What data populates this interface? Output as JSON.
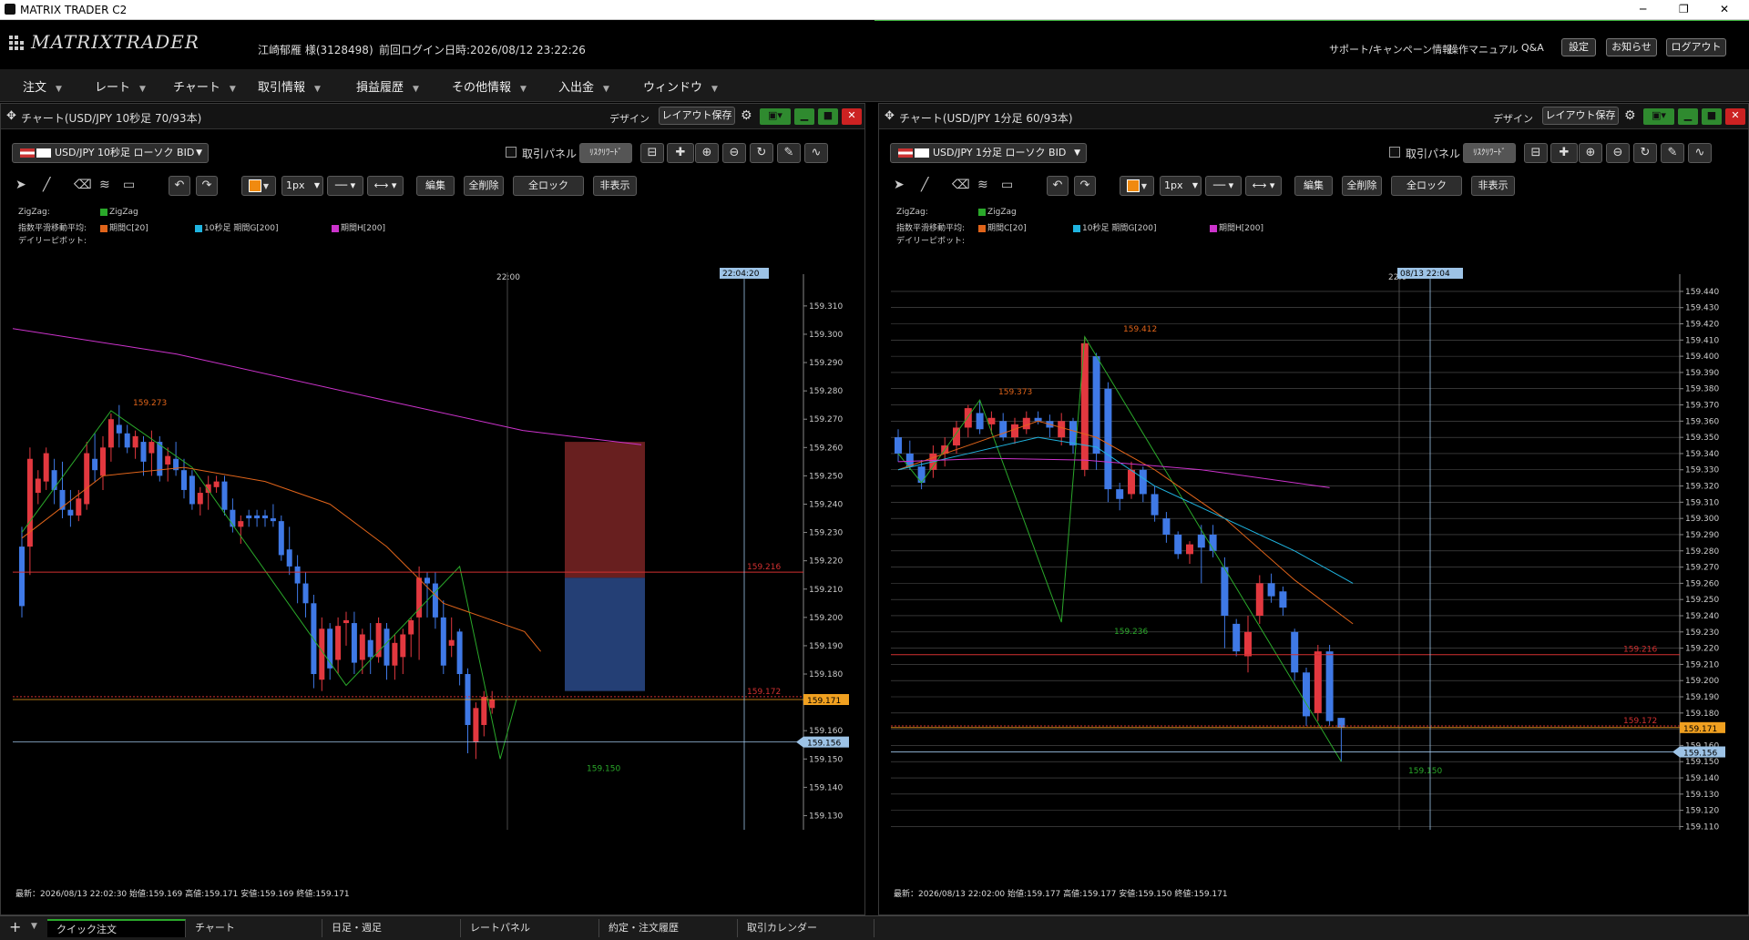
{
  "window": {
    "title": "MATRIX TRADER C2",
    "minimize": "─",
    "maximize": "❐",
    "close": "✕"
  },
  "header": {
    "logo": "MATRIXTRADER",
    "user": "江崎郁雁 様(3128498)",
    "last_login": "前回ログイン日時:2026/08/12 23:22:26",
    "links": [
      "サポート/キャンペーン情報",
      "操作マニュアル",
      "Q&A"
    ],
    "buttons": [
      "設定",
      "お知らせ",
      "ログアウト"
    ]
  },
  "menu": [
    "注文",
    "レート",
    "チャート",
    "取引情報",
    "損益履歴",
    "その他情報",
    "入出金",
    "ウィンドウ"
  ],
  "colors": {
    "up": "#e2383f",
    "down": "#3f79e6",
    "zigzag": "#2aa82a",
    "ma_c": "#e0641a",
    "ma_g": "#1fb4e0",
    "ma_h": "#cc33cc",
    "bid_tag": "#f0a020",
    "mouse_tag": "#9dc3e6"
  },
  "panels": [
    {
      "title": "チャート(USD/JPY 10秒足 70/93本)",
      "design_label": "デザイン",
      "save_label": "レイアウト保存",
      "symbol_select": "USD/JPY 10秒足 ローソク BID",
      "trade_panel_label": "取引パネル",
      "risk_reward_label": "ﾘｽｸﾘﾜｰﾄﾞ",
      "tools": {
        "linewidth": "1px",
        "edit": "編集",
        "delete_all": "全削除",
        "lock_all": "全ロック",
        "hide": "非表示"
      },
      "legend": {
        "row1_label": "ZigZag:",
        "zigzag_name": "ZigZag",
        "row2_label": "指数平滑移動平均:",
        "ma_c": "期間C[20]",
        "ma_g": "10秒足 期間G[200]",
        "ma_h": "期間H[200]",
        "row3_label": "デイリーピボット:"
      },
      "time_label": "22:00",
      "cursor_time": "22:04:20",
      "status": "最新：2026/08/13 22:02:30 始値:159.169 高値:159.171 安値:159.169 終値:159.171",
      "y_ticks": [
        "159.310",
        "159.300",
        "159.290",
        "159.280",
        "159.270",
        "159.260",
        "159.250",
        "159.240",
        "159.230",
        "159.220",
        "159.210",
        "159.200",
        "159.190",
        "159.180",
        "159.170",
        "159.160",
        "159.150",
        "159.140",
        "159.130"
      ],
      "labels": {
        "high": "159.273",
        "low": "159.150",
        "red_line": "159.216",
        "red_dotted": "159.172",
        "bid": "159.171",
        "mouse": "159.156"
      }
    },
    {
      "title": "チャート(USD/JPY 1分足 60/93本)",
      "design_label": "デザイン",
      "save_label": "レイアウト保存",
      "symbol_select": "USD/JPY 1分足 ローソク BID",
      "trade_panel_label": "取引パネル",
      "risk_reward_label": "ﾘｽｸﾘﾜｰﾄﾞ",
      "tools": {
        "linewidth": "1px",
        "edit": "編集",
        "delete_all": "全削除",
        "lock_all": "全ロック",
        "hide": "非表示"
      },
      "legend": {
        "row1_label": "ZigZag:",
        "zigzag_name": "ZigZag",
        "row2_label": "指数平滑移動平均:",
        "ma_c": "期間C[20]",
        "ma_g": "10秒足 期間G[200]",
        "ma_h": "期間H[200]",
        "row3_label": "デイリーピボット:"
      },
      "time_label": "22:0",
      "cursor_time": "08/13 22:04",
      "status": "最新：2026/08/13 22:02:00 始値:159.177 高値:159.177 安値:159.150 終値:159.171",
      "y_ticks": [
        "159.440",
        "159.430",
        "159.420",
        "159.410",
        "159.400",
        "159.390",
        "159.380",
        "159.370",
        "159.360",
        "159.350",
        "159.340",
        "159.330",
        "159.320",
        "159.310",
        "159.300",
        "159.290",
        "159.280",
        "159.270",
        "159.260",
        "159.250",
        "159.240",
        "159.230",
        "159.220",
        "159.210",
        "159.200",
        "159.190",
        "159.180",
        "159.170",
        "159.160",
        "159.150",
        "159.140",
        "159.130",
        "159.120",
        "159.110"
      ],
      "labels": {
        "high": "159.412",
        "high2": "159.373",
        "low": "159.236",
        "low2": "159.150",
        "red_line": "159.216",
        "red_dotted": "159.172",
        "bid": "159.171",
        "mouse": "159.156"
      }
    }
  ],
  "chart_data": [
    {
      "type": "candlestick",
      "title": "チャート(USD/JPY 10秒足 70/93本)",
      "ylim": [
        159.125,
        159.318
      ],
      "x": [
        "",
        "22:00",
        ""
      ],
      "ohlc": [
        [
          159.225,
          159.232,
          159.2,
          159.204
        ],
        [
          159.225,
          159.26,
          159.215,
          159.256
        ],
        [
          159.244,
          159.252,
          159.24,
          159.249
        ],
        [
          159.248,
          159.26,
          159.245,
          159.258
        ],
        [
          159.252,
          159.256,
          159.24,
          159.245
        ],
        [
          159.245,
          159.255,
          159.235,
          159.238
        ],
        [
          159.238,
          159.245,
          159.232,
          159.236
        ],
        [
          159.236,
          159.245,
          159.234,
          159.242
        ],
        [
          159.24,
          159.262,
          159.238,
          159.258
        ],
        [
          159.256,
          159.265,
          159.248,
          159.252
        ],
        [
          159.25,
          159.264,
          159.245,
          159.26
        ],
        [
          159.26,
          159.272,
          159.255,
          159.27
        ],
        [
          159.268,
          159.275,
          159.26,
          159.265
        ],
        [
          159.265,
          159.268,
          159.258,
          159.26
        ],
        [
          159.26,
          159.266,
          159.256,
          159.264
        ],
        [
          159.262,
          159.264,
          159.25,
          159.255
        ],
        [
          159.258,
          159.266,
          159.25,
          159.262
        ],
        [
          159.262,
          159.264,
          159.248,
          159.25
        ],
        [
          159.254,
          159.26,
          159.248,
          159.257
        ],
        [
          159.256,
          159.262,
          159.25,
          159.252
        ],
        [
          159.252,
          159.256,
          159.242,
          159.245
        ],
        [
          159.25,
          159.252,
          159.238,
          159.24
        ],
        [
          159.24,
          159.246,
          159.236,
          159.244
        ],
        [
          159.244,
          159.25,
          159.238,
          159.247
        ],
        [
          159.246,
          159.25,
          159.244,
          159.248
        ],
        [
          159.248,
          159.25,
          159.236,
          159.238
        ],
        [
          159.238,
          159.242,
          159.23,
          159.232
        ],
        [
          159.232,
          159.236,
          159.226,
          159.234
        ],
        [
          159.236,
          159.238,
          159.232,
          159.235
        ],
        [
          159.236,
          159.238,
          159.232,
          159.235
        ],
        [
          159.236,
          159.238,
          159.232,
          159.235
        ],
        [
          159.235,
          159.24,
          159.232,
          159.234
        ],
        [
          159.234,
          159.236,
          159.22,
          159.222
        ],
        [
          159.224,
          159.232,
          159.215,
          159.218
        ],
        [
          159.218,
          159.222,
          159.205,
          159.212
        ],
        [
          159.212,
          159.216,
          159.2,
          159.205
        ],
        [
          159.205,
          159.208,
          159.175,
          159.18
        ],
        [
          159.178,
          159.2,
          159.174,
          159.196
        ],
        [
          159.196,
          159.198,
          159.178,
          159.182
        ],
        [
          159.185,
          159.2,
          159.18,
          159.197
        ],
        [
          159.198,
          159.202,
          159.19,
          159.199
        ],
        [
          159.198,
          159.202,
          159.18,
          159.184
        ],
        [
          159.185,
          159.196,
          159.18,
          159.194
        ],
        [
          159.192,
          159.198,
          159.18,
          159.186
        ],
        [
          159.186,
          159.2,
          159.184,
          159.198
        ],
        [
          159.196,
          159.198,
          159.178,
          159.183
        ],
        [
          159.183,
          159.194,
          159.178,
          159.191
        ],
        [
          159.186,
          159.196,
          159.18,
          159.194
        ],
        [
          159.194,
          159.2,
          159.186,
          159.199
        ],
        [
          159.2,
          159.218,
          159.185,
          159.214
        ],
        [
          159.214,
          159.216,
          159.2,
          159.212
        ],
        [
          159.212,
          159.216,
          159.196,
          159.2
        ],
        [
          159.2,
          159.206,
          159.18,
          159.183
        ],
        [
          159.19,
          159.2,
          159.186,
          159.192
        ],
        [
          159.195,
          159.196,
          159.176,
          159.18
        ],
        [
          159.18,
          159.182,
          159.152,
          159.162
        ],
        [
          159.156,
          159.17,
          159.15,
          159.168
        ],
        [
          159.162,
          159.174,
          159.158,
          159.172
        ],
        [
          159.168,
          159.174,
          159.166,
          159.171
        ]
      ],
      "series": [
        {
          "name": "ZigZag",
          "values": [
            159.23,
            159.273,
            159.253,
            159.176,
            159.218,
            159.15,
            159.171
          ]
        },
        {
          "name": "期間C[20]",
          "values": [
            159.228,
            159.25,
            159.253,
            159.248,
            159.24,
            159.225,
            159.205,
            159.2,
            159.195,
            159.188
          ]
        },
        {
          "name": "期間H[200]",
          "values": [
            159.302,
            159.293,
            159.278,
            159.266,
            159.261
          ]
        }
      ],
      "annotations": [
        "159.273",
        "159.150",
        "159.216",
        "159.172",
        "159.171",
        "159.156",
        "22:04:20"
      ]
    },
    {
      "type": "candlestick",
      "title": "チャート(USD/JPY 1分足 60/93本)",
      "ylim": [
        159.108,
        159.445
      ],
      "x": [
        "22:0",
        "08/13 22:04"
      ],
      "ohlc": [
        [
          159.35,
          159.355,
          159.335,
          159.34
        ],
        [
          159.34,
          159.348,
          159.33,
          159.332
        ],
        [
          159.332,
          159.336,
          159.318,
          159.322
        ],
        [
          159.33,
          159.345,
          159.325,
          159.34
        ],
        [
          159.34,
          159.35,
          159.332,
          159.345
        ],
        [
          159.345,
          159.36,
          159.34,
          159.356
        ],
        [
          159.356,
          159.37,
          159.35,
          159.368
        ],
        [
          159.365,
          159.373,
          159.352,
          159.355
        ],
        [
          159.358,
          159.366,
          159.352,
          159.362
        ],
        [
          159.36,
          159.365,
          159.348,
          159.35
        ],
        [
          159.35,
          159.362,
          159.346,
          159.358
        ],
        [
          159.355,
          159.366,
          159.352,
          159.362
        ],
        [
          159.362,
          159.366,
          159.358,
          159.36
        ],
        [
          159.36,
          159.364,
          159.35,
          159.356
        ],
        [
          159.35,
          159.365,
          159.345,
          159.36
        ],
        [
          159.36,
          159.362,
          159.34,
          159.345
        ],
        [
          159.33,
          159.412,
          159.326,
          159.408
        ],
        [
          159.4,
          159.402,
          159.33,
          159.34
        ],
        [
          159.38,
          159.384,
          159.31,
          159.318
        ],
        [
          159.318,
          159.322,
          159.305,
          159.312
        ],
        [
          159.315,
          159.335,
          159.312,
          159.33
        ],
        [
          159.33,
          159.332,
          159.31,
          159.315
        ],
        [
          159.315,
          159.32,
          159.298,
          159.302
        ],
        [
          159.3,
          159.304,
          159.285,
          159.29
        ],
        [
          159.29,
          159.292,
          159.275,
          159.278
        ],
        [
          159.278,
          159.286,
          159.272,
          159.284
        ],
        [
          159.29,
          159.296,
          159.26,
          159.282
        ],
        [
          159.29,
          159.296,
          159.276,
          159.28
        ],
        [
          159.27,
          159.276,
          159.22,
          159.24
        ],
        [
          159.235,
          159.238,
          159.215,
          159.218
        ],
        [
          159.215,
          159.24,
          159.205,
          159.23
        ],
        [
          159.24,
          159.265,
          159.235,
          159.26
        ],
        [
          159.26,
          159.266,
          159.248,
          159.252
        ],
        [
          159.255,
          159.258,
          159.24,
          159.245
        ],
        [
          159.23,
          159.232,
          159.2,
          159.205
        ],
        [
          159.205,
          159.208,
          159.172,
          159.178
        ],
        [
          159.18,
          159.222,
          159.175,
          159.218
        ],
        [
          159.218,
          159.222,
          159.172,
          159.175
        ],
        [
          159.177,
          159.177,
          159.15,
          159.171
        ]
      ],
      "series": [
        {
          "name": "ZigZag",
          "values": [
            159.34,
            159.322,
            159.373,
            159.236,
            159.412,
            159.15
          ]
        },
        {
          "name": "期間C[20]",
          "values": [
            159.33,
            159.345,
            159.36,
            159.35,
            159.33,
            159.3,
            159.262,
            159.235
          ]
        },
        {
          "name": "10秒足 期間G[200]",
          "values": [
            159.33,
            159.34,
            159.35,
            159.344,
            159.32,
            159.3,
            159.28,
            159.26
          ]
        },
        {
          "name": "期間H[200]",
          "values": [
            159.335,
            159.337,
            159.336,
            159.33,
            159.319
          ]
        }
      ],
      "annotations": [
        "159.412",
        "159.373",
        "159.236",
        "159.150",
        "159.216",
        "159.172",
        "159.171",
        "159.156"
      ]
    }
  ]
}
